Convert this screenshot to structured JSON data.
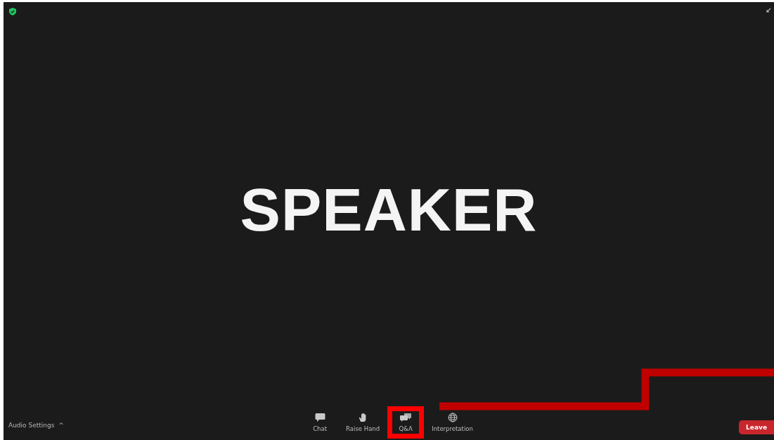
{
  "video": {
    "speaker_label": "SPEAKER"
  },
  "toolbar": {
    "audio_settings": {
      "label": "Audio Settings",
      "caret": "^"
    },
    "buttons": [
      {
        "kind": "chat",
        "label": "Chat",
        "highlighted": false
      },
      {
        "kind": "hand",
        "label": "Raise Hand",
        "highlighted": false
      },
      {
        "kind": "qa",
        "label": "Q&A",
        "highlighted": true
      },
      {
        "kind": "globe",
        "label": "Interpretation",
        "highlighted": false
      }
    ],
    "leave": {
      "label": "Leave"
    }
  }
}
